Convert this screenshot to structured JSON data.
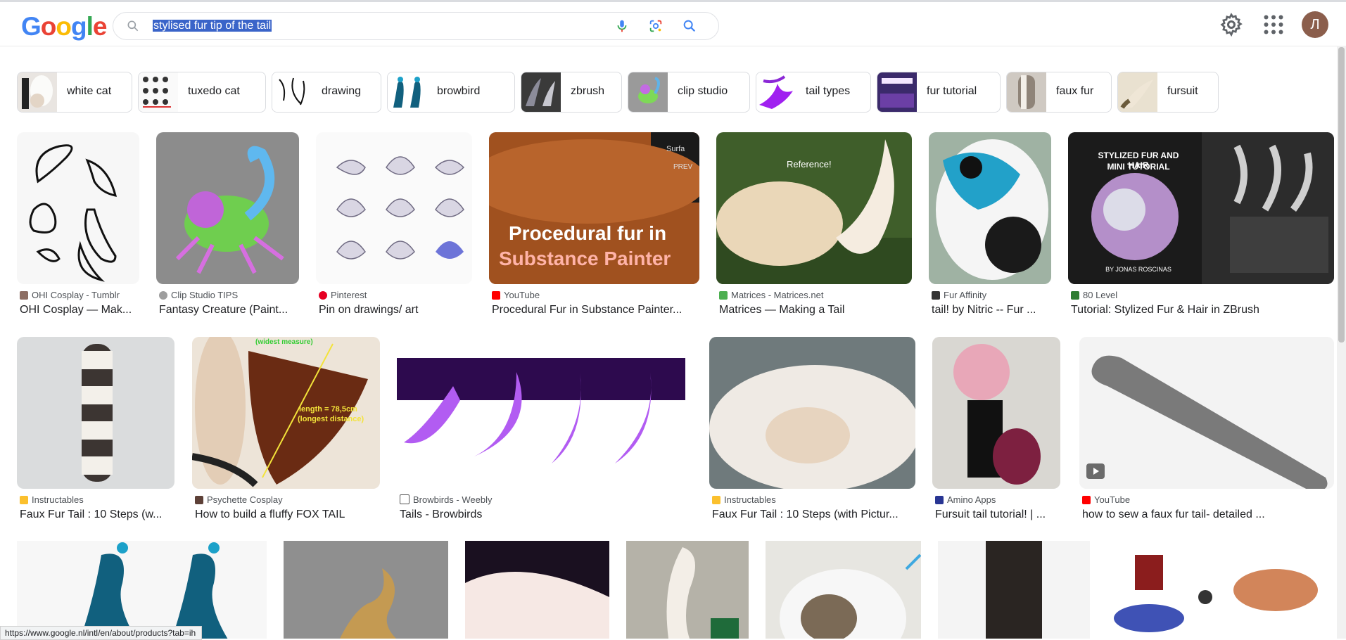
{
  "header": {
    "logo": [
      "G",
      "o",
      "o",
      "g",
      "l",
      "e"
    ],
    "search_query": "stylised fur tip of the tail",
    "avatar_letter": "Л"
  },
  "chips": [
    {
      "label": "white cat"
    },
    {
      "label": "tuxedo cat"
    },
    {
      "label": "drawing"
    },
    {
      "label": "browbird"
    },
    {
      "label": "zbrush"
    },
    {
      "label": "clip studio"
    },
    {
      "label": "tail types"
    },
    {
      "label": "fur tutorial"
    },
    {
      "label": "faux fur"
    },
    {
      "label": "fursuit"
    }
  ],
  "results_row1": [
    {
      "source": "OHI Cosplay - Tumblr",
      "title": "OHI Cosplay — Mak..."
    },
    {
      "source": "Clip Studio TIPS",
      "title": "Fantasy Creature (Paint..."
    },
    {
      "source": "Pinterest",
      "title": "Pin on drawings/ art"
    },
    {
      "source": "YouTube",
      "title": "Procedural Fur in Substance Painter..."
    },
    {
      "source": "Matrices - Matrices.net",
      "title": "Matrices — Making a Tail"
    },
    {
      "source": "Fur Affinity",
      "title": "tail! by Nitric -- Fur ..."
    },
    {
      "source": "80 Level",
      "title": "Tutorial: Stylized Fur & Hair in ZBrush"
    }
  ],
  "results_row2": [
    {
      "source": "Instructables",
      "title": "Faux Fur Tail : 10 Steps (w..."
    },
    {
      "source": "Psychette Cosplay",
      "title": "How to build a fluffy FOX TAIL"
    },
    {
      "source": "Browbirds - Weebly",
      "title": "Tails - Browbirds"
    },
    {
      "source": "Instructables",
      "title": "Faux Fur Tail : 10 Steps (with Pictur..."
    },
    {
      "source": "Amino Apps",
      "title": "Fursuit tail tutorial! | ..."
    },
    {
      "source": "YouTube",
      "title": "how to sew a faux fur tail- detailed ..."
    }
  ],
  "image_text": {
    "procedural_line1": "Procedural fur in",
    "procedural_line2": "Substance Painter",
    "surface": "Surfa",
    "preview": "PREV",
    "reference": "Reference!",
    "stylized_title": "STYLIZED FUR AND HAIR",
    "stylized_sub": "MINI TUTORIAL",
    "stylized_author": "BY JONAS ROSCINAS",
    "widest_measure": "(widest measure)",
    "length": "length = 78,5cm",
    "longest": "(longest distance)"
  },
  "status_url": "https://www.google.nl/intl/en/about/products?tab=ih",
  "colors": {
    "google_blue": "#4285f4",
    "google_red": "#ea4335",
    "google_yellow": "#fbbc05",
    "google_green": "#34a853",
    "selection": "#3a64c9"
  }
}
